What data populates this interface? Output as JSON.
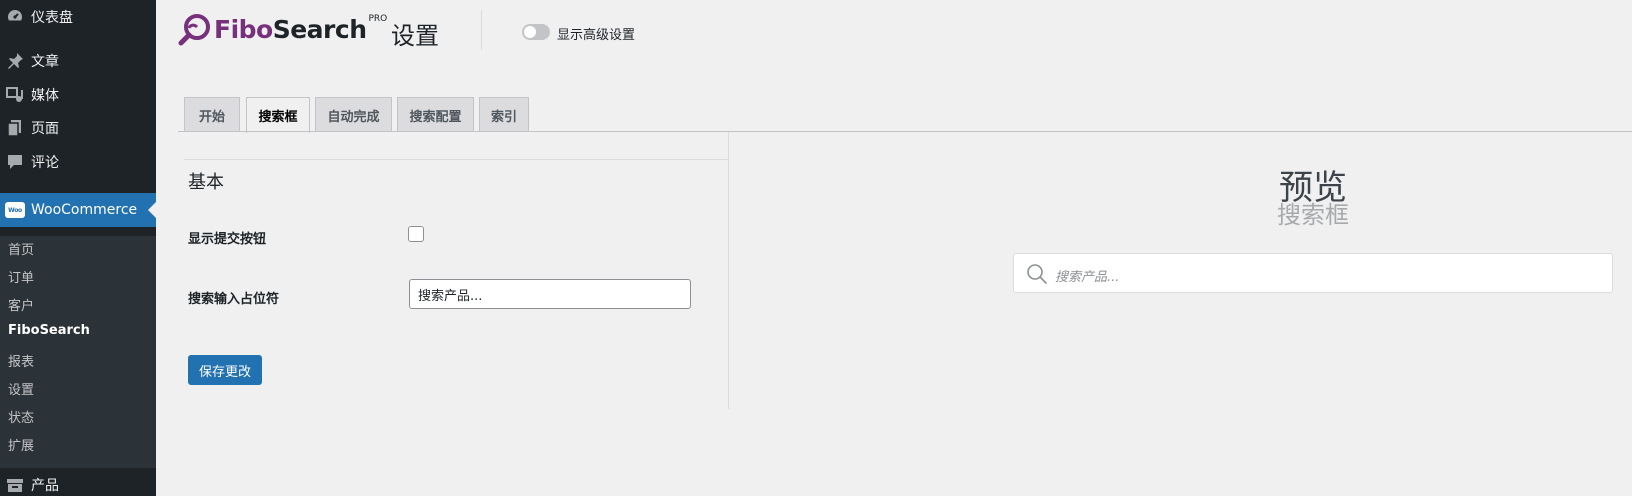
{
  "sidebar": {
    "dashboard": "仪表盘",
    "posts": "文章",
    "media": "媒体",
    "pages": "页面",
    "comments": "评论",
    "woocommerce": "WooCommerce",
    "woo_badge": "Woo",
    "submenu": [
      "首页",
      "订单",
      "客户",
      "FiboSearch",
      "报表",
      "设置",
      "状态",
      "扩展"
    ],
    "products": "产品"
  },
  "header": {
    "brand_fibo": "Fibo",
    "brand_search": "Search",
    "brand_pro": "PRO",
    "page_title": "设置",
    "advanced_toggle_label": "显示高级设置"
  },
  "tabs": [
    "开始",
    "搜索框",
    "自动完成",
    "搜索配置",
    "索引"
  ],
  "active_tab": "搜索框",
  "form": {
    "section_title": "基本",
    "show_submit_label": "显示提交按钮",
    "placeholder_label": "搜索输入占位符",
    "placeholder_value": "搜索产品...",
    "save_label": "保存更改"
  },
  "preview": {
    "title": "预览",
    "subtitle": "搜索框",
    "search_placeholder": "搜索产品..."
  },
  "colors": {
    "sidebar_bg": "#1d2327",
    "accent": "#2271b1",
    "brand_purple": "#77307c"
  }
}
